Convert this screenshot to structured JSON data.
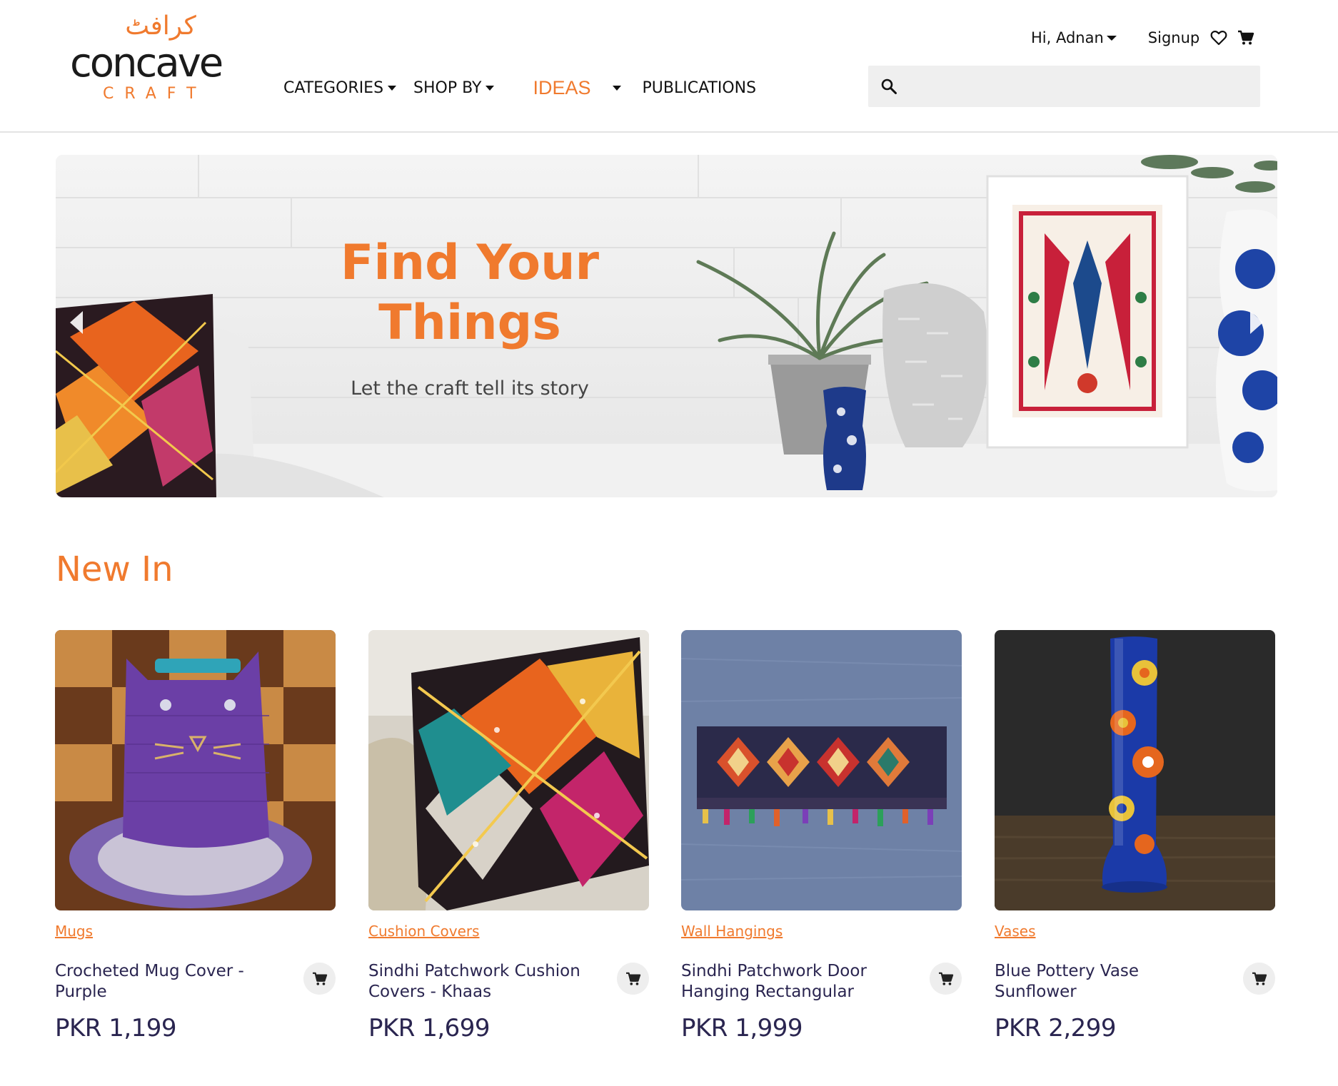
{
  "brand": {
    "name": "concave",
    "sub": "CRAFT",
    "urdu": "کرافٹ"
  },
  "nav": {
    "categories": "CATEGORIES",
    "shop_by": "SHOP BY",
    "ideas": "IDEAS",
    "publications": "PUBLICATIONS"
  },
  "user": {
    "greeting": "Hi, Adnan",
    "signup": "Signup"
  },
  "search": {
    "placeholder": "",
    "value": ""
  },
  "hero": {
    "title": "Find Your\nThings",
    "subtitle": "Let the craft tell its story"
  },
  "new_in": {
    "title": "New In",
    "products": [
      {
        "category": "Mugs",
        "name": "Crocheted Mug Cover - Purple",
        "price": "PKR 1,199"
      },
      {
        "category": "Cushion Covers",
        "name": "Sindhi Patchwork Cushion Covers - Khaas",
        "price": "PKR 1,699"
      },
      {
        "category": "Wall Hangings",
        "name": "Sindhi Patchwork Door Hanging Rectangular",
        "price": "PKR 1,999"
      },
      {
        "category": "Vases",
        "name": "Blue Pottery Vase Sunflower",
        "price": "PKR 2,299"
      }
    ]
  },
  "colors": {
    "accent": "#f07a2e",
    "text_dark": "#2a2550",
    "search_bg": "#efefef"
  },
  "icons": [
    "search-icon",
    "heart-icon",
    "cart-icon",
    "chevron-left-icon",
    "chevron-right-icon",
    "add-to-cart-icon"
  ]
}
